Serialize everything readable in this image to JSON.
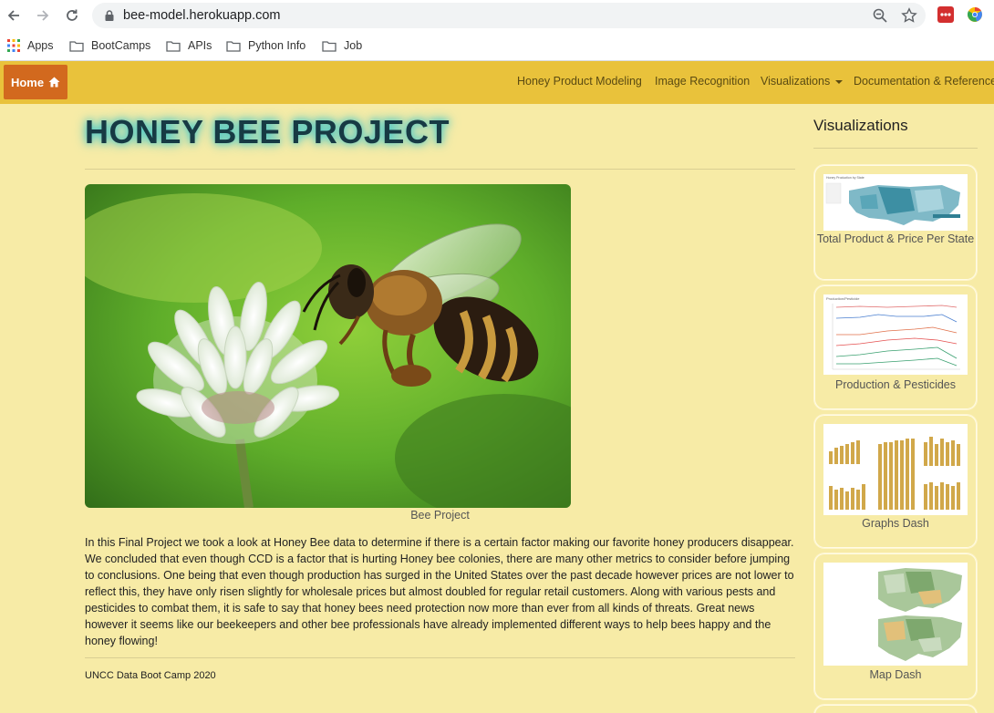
{
  "browser": {
    "url": "bee-model.herokuapp.com",
    "bookmarks": [
      {
        "label": "Apps",
        "icon": "apps-grid-icon"
      },
      {
        "label": "BootCamps",
        "icon": "folder-icon"
      },
      {
        "label": "APIs",
        "icon": "folder-icon"
      },
      {
        "label": "Python Info",
        "icon": "folder-icon"
      },
      {
        "label": "Job",
        "icon": "folder-icon"
      }
    ]
  },
  "navbar": {
    "home_label": "Home",
    "links": [
      {
        "label": "Honey Product Modeling"
      },
      {
        "label": "Image Recognition"
      },
      {
        "label": "Visualizations",
        "dropdown": true
      },
      {
        "label": "Documentation & References"
      }
    ]
  },
  "main": {
    "title": "HONEY BEE PROJECT",
    "image_caption": "Bee Project",
    "paragraph": "In this Final Project we took a look at Honey Bee data to determine if there is a certain factor making our favorite honey producers disappear. We concluded that even though CCD is a factor that is hurting Honey bee colonies, there are many other metrics to consider before jumping to conclusions. One being that even though production has surged in the United States over the past decade however prices are not lower to reflect this, they have only risen slightly for wholesale prices but almost doubled for regular retail customers. Along with various pests and pesticides to combat them, it is safe to say that honey bees need protection now more than ever from all kinds of threats. Great news however it seems like our beekeepers and other bee professionals have already implemented different ways to help bees happy and the honey flowing!",
    "footer": "UNCC Data Boot Camp 2020"
  },
  "sidebar": {
    "title": "Visualizations",
    "cards": [
      {
        "label": "Total Product & Price Per State",
        "thumb_caption": "Honey Production by State"
      },
      {
        "label": "Production & Pesticides",
        "thumb_caption": "Production/Pesticide"
      },
      {
        "label": "Graphs Dash",
        "thumb_caption": ""
      },
      {
        "label": "Map Dash",
        "thumb_caption": ""
      }
    ]
  },
  "colors": {
    "page_bg": "#f7eba6",
    "navbar": "#e9c23b",
    "home_button": "#d2691e",
    "title_glow": "#43c6c9"
  }
}
